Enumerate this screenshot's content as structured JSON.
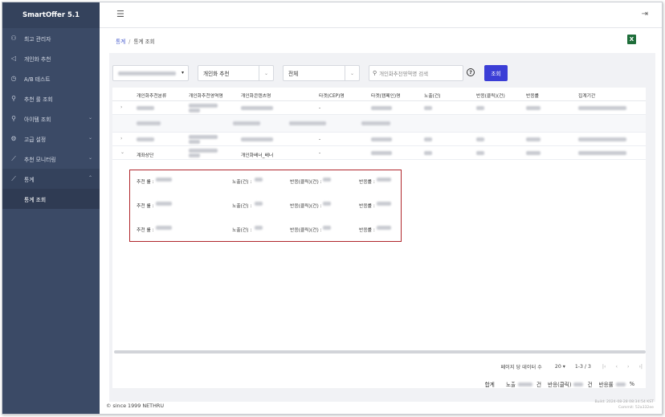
{
  "app": {
    "title": "SmartOffer 5.1"
  },
  "sidebar": {
    "items": [
      {
        "label": "최고 관리자",
        "icon": "user-icon"
      },
      {
        "label": "개인화 추천",
        "icon": "send-icon"
      },
      {
        "label": "A/B 테스트",
        "icon": "clock-icon"
      },
      {
        "label": "추천 룰 조회",
        "icon": "search-icon"
      },
      {
        "label": "아이템 조회",
        "icon": "search-icon"
      },
      {
        "label": "고급 설정",
        "icon": "gear-icon"
      },
      {
        "label": "추천 모니터링",
        "icon": "chart-icon"
      },
      {
        "label": "통계",
        "icon": "chart-icon"
      }
    ],
    "sub_items": [
      {
        "label": "통계 조회"
      }
    ]
  },
  "breadcrumb": {
    "home": "통계",
    "separator": "/",
    "current": "통계 조회"
  },
  "filters": {
    "recommend_type": "개인화 추천",
    "scope": "전체",
    "search_placeholder": "개인화추천영역명 검색",
    "search_button": "조회",
    "help": "?"
  },
  "table": {
    "headers": [
      "개인화추천분류",
      "개인화추천영역명",
      "개인화콘텐츠명",
      "타겟(CEP)명",
      "타겟(캠페인)명",
      "노출(건)",
      "반응(클릭)(건)",
      "반응률",
      "집계기간"
    ],
    "rows": [
      {
        "expander": "›",
        "c3": "-"
      },
      {
        "expander": "",
        "c3": ""
      },
      {
        "expander": "›",
        "c3": "-"
      },
      {
        "expander": "⌄",
        "category": "계좌상단",
        "content": "개인화배너_배너",
        "c3": "-"
      }
    ]
  },
  "detail": {
    "lines": [
      {
        "rule": "추천 룰 :",
        "impression": "노출(건) :",
        "click": "반응(클릭)(건) :",
        "rate": "반응률 :"
      },
      {
        "rule": "추천 룰 :",
        "impression": "노출(건) :",
        "click": "반응(클릭)(건) :",
        "rate": "반응률 :"
      },
      {
        "rule": "추천 룰 :",
        "impression": "노출(건) :",
        "click": "반응(클릭)(건) :",
        "rate": "반응률 :"
      }
    ]
  },
  "pager": {
    "rows_label": "페이지 당 데이터 수",
    "rows_value": "20",
    "range": "1-3 / 3",
    "first": "|‹",
    "prev": "‹",
    "next": "›",
    "last": "›|"
  },
  "totals": {
    "label": "합계",
    "impression_label": "노출",
    "impression_unit": "건",
    "click_label": "반응(클릭)",
    "click_unit": "건",
    "rate_label": "반응률",
    "rate_unit": "%"
  },
  "footer": {
    "copyright": "© since 1999 NETHRU"
  },
  "build": {
    "line1": "Build: 2024-08-28 08:34:54 KST",
    "line2": "Commit: 52a332ee"
  }
}
